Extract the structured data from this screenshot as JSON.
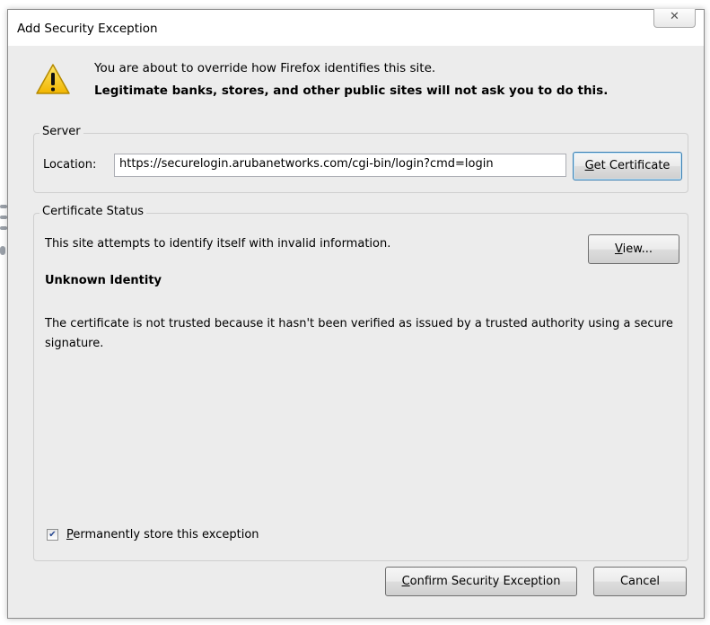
{
  "dialog": {
    "title": "Add Security Exception",
    "close_glyph": "✕"
  },
  "warning": {
    "icon": "warning-triangle-icon",
    "message": "You are about to override how Firefox identifies this site.",
    "emphasis": "Legitimate banks, stores, and other public sites will not ask you to do this."
  },
  "server": {
    "group_label": "Server",
    "location_label": "Location:",
    "location_value": "https://securelogin.arubanetworks.com/cgi-bin/login?cmd=login",
    "get_certificate": {
      "accel": "G",
      "rest": "et Certificate"
    }
  },
  "status": {
    "group_label": "Certificate Status",
    "summary": "This site attempts to identify itself with invalid information.",
    "view_button": {
      "accel": "V",
      "rest": "iew..."
    },
    "heading": "Unknown Identity",
    "detail": "The certificate is not trusted because it hasn't been verified as issued by a trusted authority using a secure signature."
  },
  "permanent": {
    "checked": true,
    "accel": "P",
    "rest": "ermanently store this exception"
  },
  "buttons": {
    "confirm": {
      "accel": "C",
      "rest": "onfirm Security Exception"
    },
    "cancel": "Cancel"
  },
  "colors": {
    "dialog_bg": "#ececec",
    "warning_yellow": "#f4c400",
    "focus_border": "#3c7fb1"
  }
}
